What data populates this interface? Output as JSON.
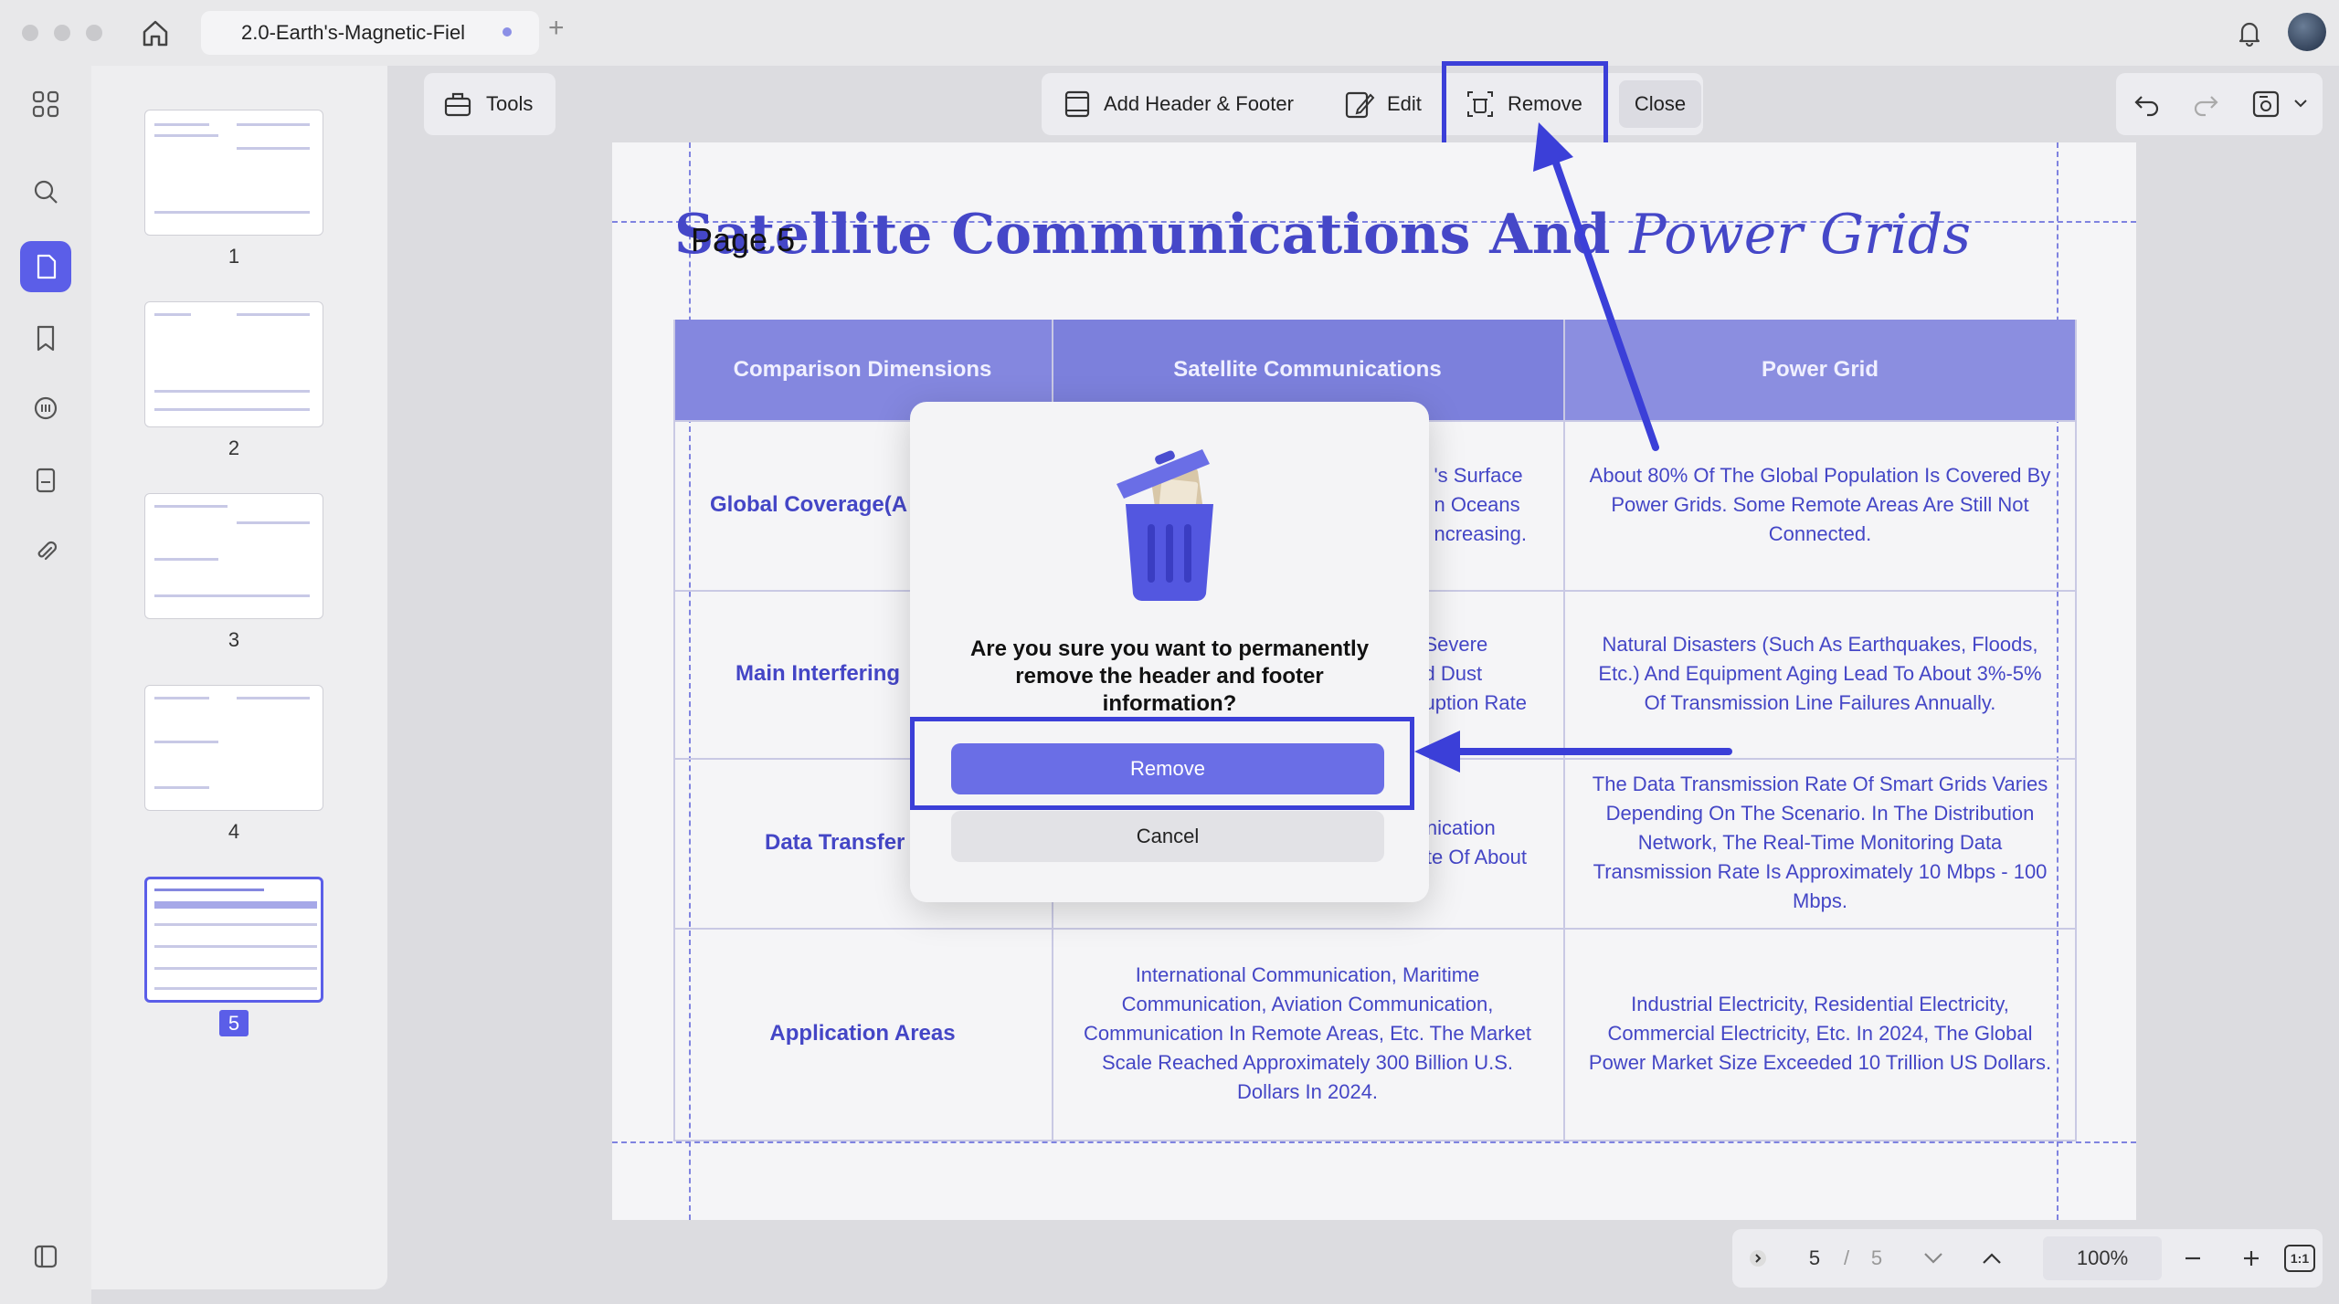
{
  "window": {
    "tab_title": "2.0-Earth's-Magnetic-Fiel",
    "tab_add": "+"
  },
  "thumbnails": [
    {
      "label": "1"
    },
    {
      "label": "2"
    },
    {
      "label": "3"
    },
    {
      "label": "4"
    },
    {
      "label": "5"
    }
  ],
  "toolbar": {
    "tools_label": "Tools",
    "add_header_footer_label": "Add Header & Footer",
    "edit_label": "Edit",
    "remove_label": "Remove",
    "close_label": "Close"
  },
  "document": {
    "title_bold": "Satellite Communications And ",
    "title_italic": "Power Grids",
    "page_label": "Page 5",
    "table": {
      "headers": [
        "Comparison Dimensions",
        "Satellite Communications",
        "Power Grid"
      ],
      "rows": [
        {
          "label": "Global Coverage(A",
          "satellite": "'s Surface\nn Oceans\nncreasing.",
          "power": "About 80% Of The Global Population Is Covered By Power Grids. Some Remote Areas Are Still Not Connected."
        },
        {
          "label": "Main Interfering",
          "satellite": "Severe\nd Dust\nuption Rate",
          "power": "Natural Disasters (Such As Earthquakes, Floods, Etc.) And Equipment Aging Lead To About 3%-5% Of Transmission Line Failures Annually."
        },
        {
          "label": "Data Transfer",
          "satellite": "nication\nte Of About",
          "power": "The Data Transmission Rate Of Smart Grids Varies Depending On The Scenario. In The Distribution Network, The Real-Time Monitoring Data Transmission Rate Is Approximately 10 Mbps - 100 Mbps."
        },
        {
          "label": "Application Areas",
          "satellite": "International Communication, Maritime Communication, Aviation Communication, Communication In Remote Areas, Etc. The Market Scale Reached Approximately 300 Billion U.S. Dollars In 2024.",
          "power": "Industrial Electricity, Residential Electricity, Commercial Electricity, Etc. In 2024, The Global Power Market Size Exceeded 10 Trillion US Dollars."
        }
      ]
    }
  },
  "modal": {
    "message": "Are you sure you want to permanently remove the header and footer information?",
    "remove_label": "Remove",
    "cancel_label": "Cancel"
  },
  "pager": {
    "current": "5",
    "separator": "/",
    "total": "5",
    "zoom": "100%",
    "fit_label": "1:1"
  },
  "colors": {
    "accent": "#5b5ee8",
    "highlight": "#3b3fd8",
    "table_header": "#8487df",
    "table_text": "#4446c6"
  }
}
